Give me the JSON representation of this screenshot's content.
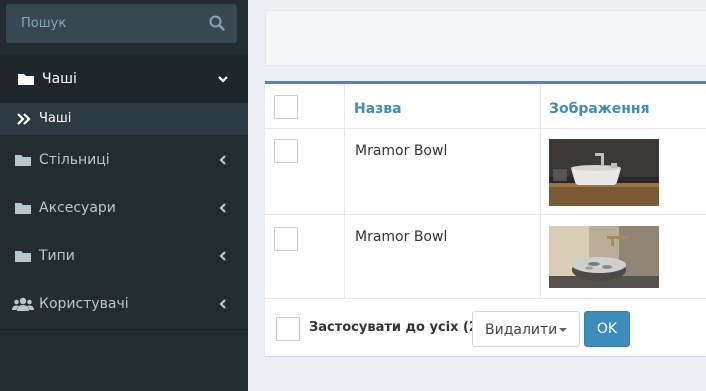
{
  "sidebar": {
    "search": {
      "placeholder": "Пошук"
    },
    "items": [
      {
        "label": "Чаші",
        "expanded": true
      },
      {
        "label": "Стільниці",
        "expanded": false
      },
      {
        "label": "Аксесуари",
        "expanded": false
      },
      {
        "label": "Типи",
        "expanded": false
      },
      {
        "label": "Користувачі",
        "expanded": false
      }
    ],
    "submenu": [
      {
        "label": "Чаші"
      }
    ]
  },
  "table": {
    "headers": {
      "name": "Назва",
      "image": "Зображення"
    },
    "rows": [
      {
        "name": "Mramor Bowl",
        "image_desc": "sink-photo-1"
      },
      {
        "name": "Mramor Bowl",
        "image_desc": "sink-photo-2"
      }
    ]
  },
  "actions": {
    "apply_label": "Застосувати до усіх (2)",
    "select_value": "Видалити",
    "ok_label": "OK"
  },
  "colors": {
    "accent": "#3c8dbc",
    "sidebar_bg": "#222d32"
  }
}
